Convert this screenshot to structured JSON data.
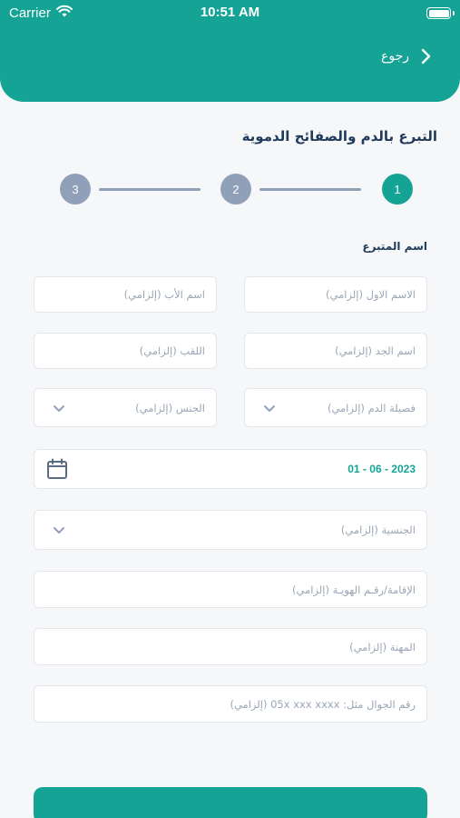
{
  "status_bar": {
    "carrier": "Carrier",
    "time": "10:51 AM"
  },
  "header": {
    "back_label": "رجوع"
  },
  "page": {
    "title": "التبرع بالدم والصفائح الدموية"
  },
  "stepper": {
    "steps": [
      "1",
      "2",
      "3"
    ],
    "active_step": 1
  },
  "form": {
    "section_label": "اسم المتبرع",
    "first_name_placeholder": "الاسم الاول (إلزامي)",
    "father_name_placeholder": "اسم الأب (إلزامي)",
    "grandfather_name_placeholder": "اسم الجد (إلزامي)",
    "family_name_placeholder": "اللقب (إلزامي)",
    "blood_type_placeholder": "فصيلة الدم (إلزامي)",
    "gender_placeholder": "الجنس (إلزامي)",
    "birth_date_value": "2023 - 06 - 01",
    "nationality_placeholder": "الجنسية (إلزامي)",
    "id_number_placeholder": "الإقامة/رقـم الهويـة (إلزامي)",
    "occupation_placeholder": "المهنة (إلزامي)",
    "mobile_placeholder": "رقم الجوال مثل: 05x xxx xxxx (إلزامي)"
  },
  "colors": {
    "accent": "#14a394",
    "step_inactive": "#8fa0b8",
    "title": "#1f3a5a",
    "placeholder": "#9aa6b6"
  },
  "icons": {
    "back": "chevron-right-icon",
    "dropdown": "chevron-down-icon",
    "date": "calendar-icon"
  }
}
